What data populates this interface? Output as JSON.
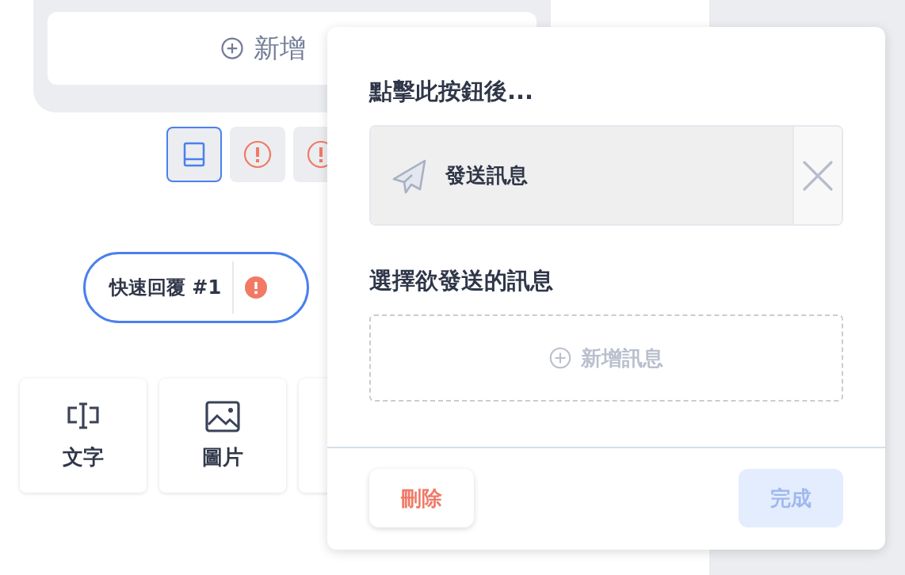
{
  "editor": {
    "add_button": {
      "label": "新增"
    },
    "tool_buttons": [
      {
        "kind": "layout",
        "selected": true
      },
      {
        "kind": "alert",
        "selected": false
      },
      {
        "kind": "alert",
        "selected": false
      }
    ],
    "quick_reply": {
      "label": "快速回覆 #1",
      "alert": true
    },
    "message_types": [
      {
        "kind": "text",
        "label": "文字"
      },
      {
        "kind": "image",
        "label": "圖片"
      },
      {
        "kind": "hidden"
      }
    ]
  },
  "popover": {
    "action_title": "點擊此按鈕後...",
    "action": {
      "kind": "send",
      "label": "發送訊息"
    },
    "message_title": "選擇欲發送的訊息",
    "add_message": {
      "label": "新增訊息"
    },
    "buttons": [
      {
        "kind": "danger",
        "label": "刪除",
        "disabled": false
      },
      {
        "kind": "primary",
        "label": "完成",
        "disabled": true
      }
    ]
  }
}
